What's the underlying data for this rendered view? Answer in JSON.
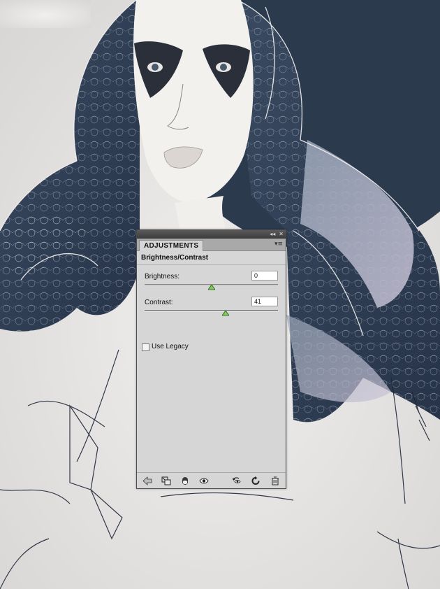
{
  "panel": {
    "tab_label": "ADJUSTMENTS",
    "title": "Brightness/Contrast",
    "controls": [
      {
        "label": "Brightness:",
        "value": "0",
        "range": [
          -150,
          150
        ]
      },
      {
        "label": "Contrast:",
        "value": "41",
        "range": [
          -50,
          100
        ]
      }
    ],
    "use_legacy": {
      "label": "Use Legacy",
      "checked": false
    },
    "footer_icons": [
      "back-arrow-icon",
      "panel-expand-icon",
      "clip-to-layer-icon",
      "visibility-eye-icon",
      "view-previous-icon",
      "reset-icon",
      "trash-icon"
    ]
  },
  "colors": {
    "panel_bg": "#d6d6d6",
    "titlebar": "#4a4a4a",
    "slider_thumb": "#7ecb5a",
    "hair_dark": "#2f3e53",
    "background_sphere": "#2c3a4e"
  }
}
